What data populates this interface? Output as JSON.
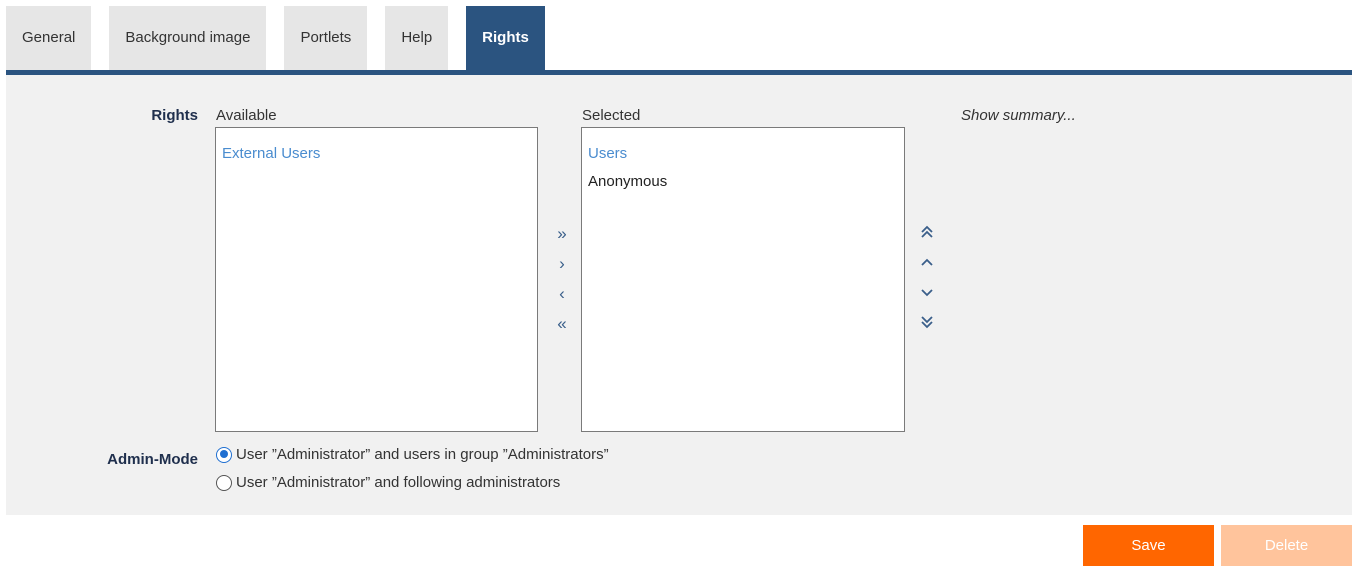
{
  "tabs": [
    {
      "label": "General",
      "active": false
    },
    {
      "label": "Background image",
      "active": false
    },
    {
      "label": "Portlets",
      "active": false
    },
    {
      "label": "Help",
      "active": false
    },
    {
      "label": "Rights",
      "active": true
    }
  ],
  "rights": {
    "label": "Rights",
    "available": {
      "header": "Available",
      "items": [
        "External Users"
      ],
      "selected_index": 0
    },
    "selected": {
      "header": "Selected",
      "items": [
        "Users",
        "Anonymous"
      ],
      "selected_index": 0
    },
    "transfer_buttons": {
      "add_all": "»",
      "add": "›",
      "remove": "‹",
      "remove_all": "«"
    },
    "order_buttons": {
      "top": "⌃⌃",
      "up": "⌃",
      "down": "⌄",
      "bottom": "⌄⌄"
    },
    "summary_link": "Show summary..."
  },
  "admin_mode": {
    "label": "Admin-Mode",
    "options": [
      {
        "label": "User ”Administrator” and users in group ”Administrators”",
        "checked": true
      },
      {
        "label": "User ”Administrator” and following administrators",
        "checked": false
      }
    ]
  },
  "actions": {
    "save": "Save",
    "delete": "Delete"
  },
  "colors": {
    "accent": "#2b5480",
    "save": "#ff6600",
    "delete_disabled": "#ffc49c",
    "selected_item": "#4a8ccf"
  }
}
